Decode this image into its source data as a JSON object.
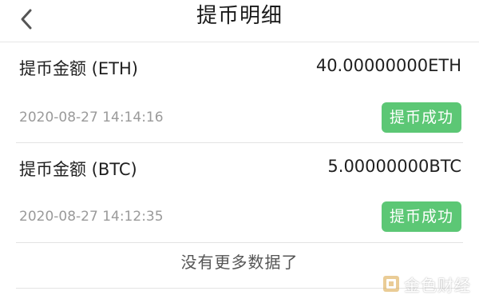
{
  "header": {
    "title": "提币明细"
  },
  "records": [
    {
      "label": "提币金额 (ETH)",
      "amount": "40.00000000ETH",
      "time": "2020-08-27 14:14:16",
      "status": "提币成功"
    },
    {
      "label": "提币金额 (BTC)",
      "amount": "5.00000000BTC",
      "time": "2020-08-27 14:12:35",
      "status": "提币成功"
    }
  ],
  "footer": {
    "no_more_text": "没有更多数据了"
  },
  "watermark": {
    "text": "金色财经"
  },
  "colors": {
    "status_success": "#5cc775",
    "divider": "#e3e3e3"
  }
}
